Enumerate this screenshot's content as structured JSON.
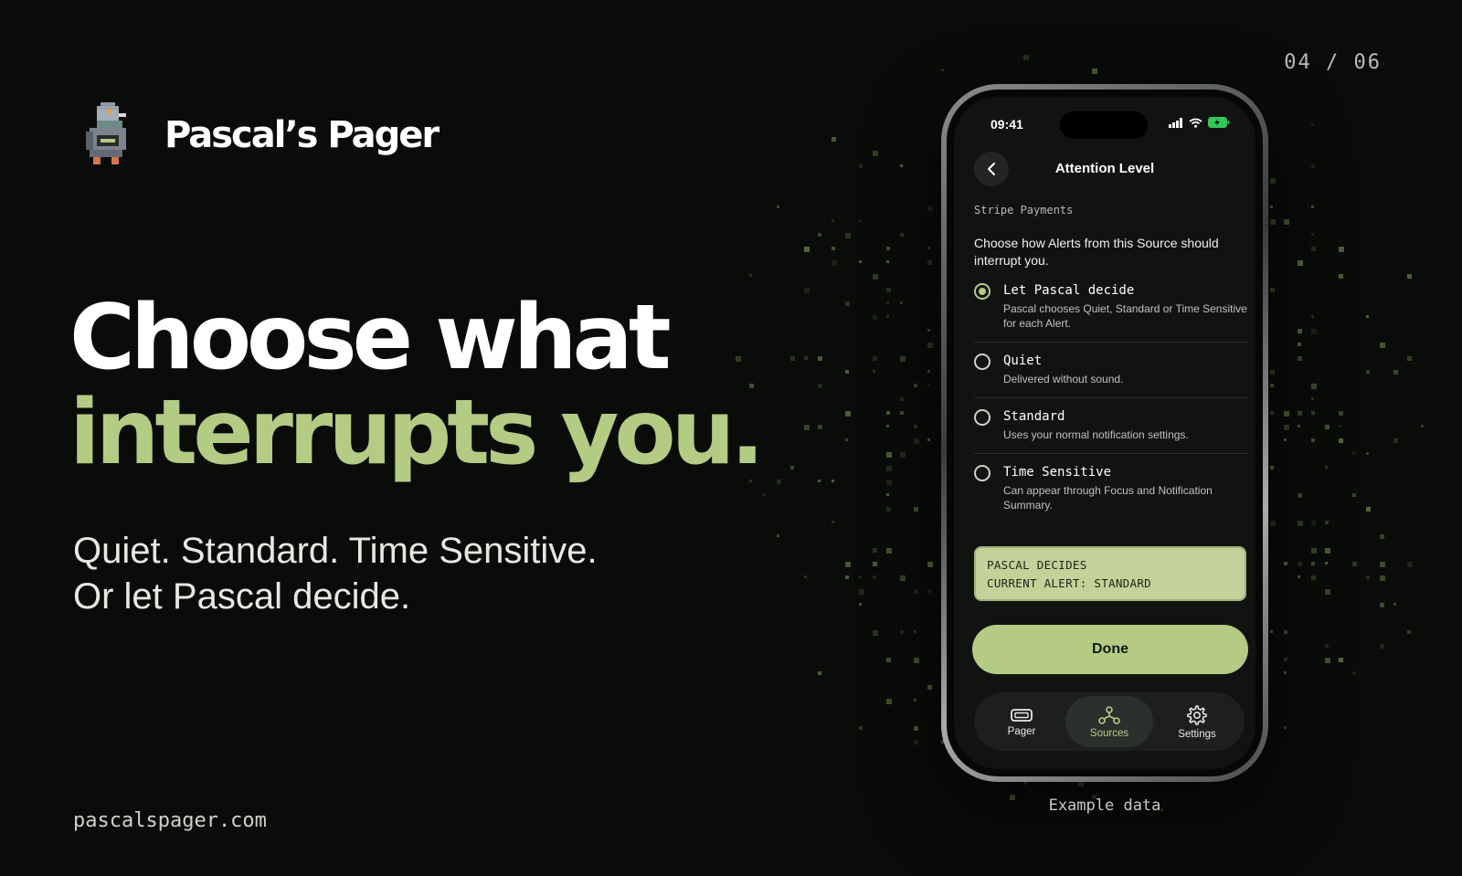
{
  "page": {
    "counter": "04 / 06",
    "brand_name": "Pascal’s Pager",
    "headline_line1": "Choose what",
    "headline_line2": "interrupts you.",
    "subheadline_line1": "Quiet. Standard. Time Sensitive.",
    "subheadline_line2": "Or let Pascal decide.",
    "url": "pascalspager.com",
    "example_caption": "Example data",
    "colors": {
      "accent": "#b4cb84",
      "background": "#0a0c0a",
      "status_box": "#c4d29a"
    }
  },
  "phone": {
    "time": "09:41",
    "nav_title": "Attention Level",
    "source_name": "Stripe Payments",
    "description": "Choose how Alerts from this Source should interrupt you.",
    "options": [
      {
        "title": "Let Pascal decide",
        "desc": "Pascal chooses Quiet, Standard or Time Sensitive for each Alert.",
        "selected": true
      },
      {
        "title": "Quiet",
        "desc": "Delivered without sound.",
        "selected": false
      },
      {
        "title": "Standard",
        "desc": "Uses your normal notification settings.",
        "selected": false
      },
      {
        "title": "Time Sensitive",
        "desc": "Can appear through Focus and Notification Summary.",
        "selected": false
      }
    ],
    "status_line1": "PASCAL DECIDES",
    "status_line2": "CURRENT ALERT: STANDARD",
    "done_label": "Done",
    "tabs": [
      {
        "label": "Pager",
        "icon": "pager-icon",
        "active": false
      },
      {
        "label": "Sources",
        "icon": "sources-icon",
        "active": true
      },
      {
        "label": "Settings",
        "icon": "gear-icon",
        "active": false
      }
    ]
  }
}
